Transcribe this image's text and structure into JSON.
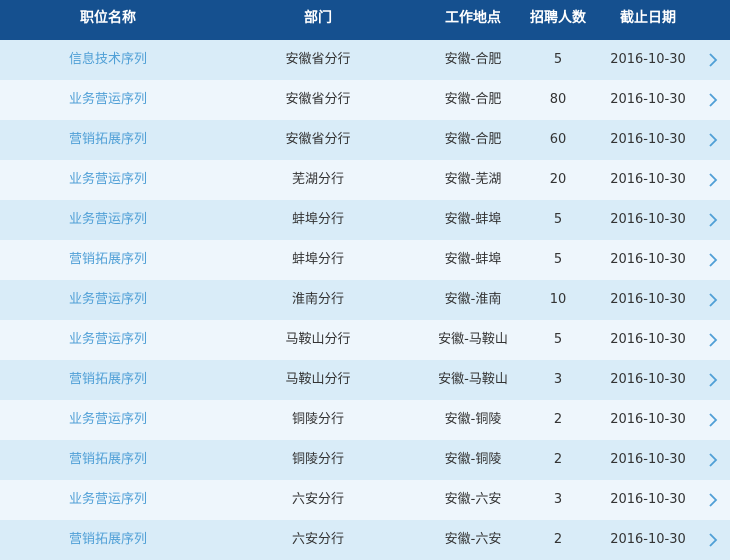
{
  "header": {
    "position": "职位名称",
    "department": "部门",
    "location": "工作地点",
    "headcount": "招聘人数",
    "deadline": "截止日期"
  },
  "colors": {
    "header_bg": "#15508f",
    "row_odd": "#d9ecf8",
    "row_even": "#eef6fc",
    "position_link": "#4f9fd6",
    "arrow": "#4f9fd6"
  },
  "rows": [
    {
      "position": "信息技术序列",
      "department": "安徽省分行",
      "location": "安徽-合肥",
      "headcount": "5",
      "deadline": "2016-10-30"
    },
    {
      "position": "业务营运序列",
      "department": "安徽省分行",
      "location": "安徽-合肥",
      "headcount": "80",
      "deadline": "2016-10-30"
    },
    {
      "position": "营销拓展序列",
      "department": "安徽省分行",
      "location": "安徽-合肥",
      "headcount": "60",
      "deadline": "2016-10-30"
    },
    {
      "position": "业务营运序列",
      "department": "芜湖分行",
      "location": "安徽-芜湖",
      "headcount": "20",
      "deadline": "2016-10-30"
    },
    {
      "position": "业务营运序列",
      "department": "蚌埠分行",
      "location": "安徽-蚌埠",
      "headcount": "5",
      "deadline": "2016-10-30"
    },
    {
      "position": "营销拓展序列",
      "department": "蚌埠分行",
      "location": "安徽-蚌埠",
      "headcount": "5",
      "deadline": "2016-10-30"
    },
    {
      "position": "业务营运序列",
      "department": "淮南分行",
      "location": "安徽-淮南",
      "headcount": "10",
      "deadline": "2016-10-30"
    },
    {
      "position": "业务营运序列",
      "department": "马鞍山分行",
      "location": "安徽-马鞍山",
      "headcount": "5",
      "deadline": "2016-10-30"
    },
    {
      "position": "营销拓展序列",
      "department": "马鞍山分行",
      "location": "安徽-马鞍山",
      "headcount": "3",
      "deadline": "2016-10-30"
    },
    {
      "position": "业务营运序列",
      "department": "铜陵分行",
      "location": "安徽-铜陵",
      "headcount": "2",
      "deadline": "2016-10-30"
    },
    {
      "position": "营销拓展序列",
      "department": "铜陵分行",
      "location": "安徽-铜陵",
      "headcount": "2",
      "deadline": "2016-10-30"
    },
    {
      "position": "业务营运序列",
      "department": "六安分行",
      "location": "安徽-六安",
      "headcount": "3",
      "deadline": "2016-10-30"
    },
    {
      "position": "营销拓展序列",
      "department": "六安分行",
      "location": "安徽-六安",
      "headcount": "2",
      "deadline": "2016-10-30"
    }
  ]
}
